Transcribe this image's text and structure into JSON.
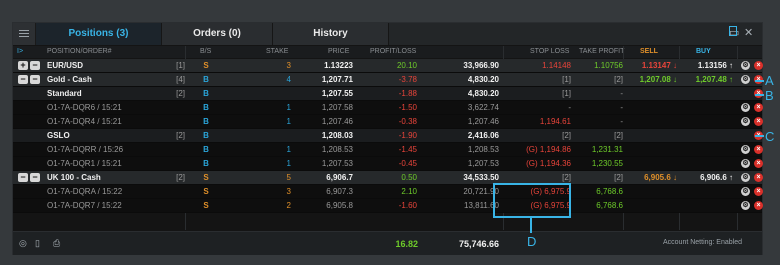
{
  "tabs": [
    {
      "label": "Positions (3)",
      "active": true
    },
    {
      "label": "Orders (0)",
      "active": false
    },
    {
      "label": "History",
      "active": false
    }
  ],
  "window_controls": {
    "minimize": "▭",
    "close": "✕"
  },
  "columns": {
    "position_order": "POSITION/ORDER#",
    "bs": "B/S",
    "stake": "STAKE",
    "price": "PRICE",
    "profit_loss": "PROFIT/LOSS",
    "stop_loss": "STOP LOSS",
    "take_profit": "TAKE PROFIT",
    "sell": "SELL",
    "buy": "BUY"
  },
  "rows": [
    {
      "level": 1,
      "expander": "+",
      "name": "EUR/USD",
      "tag": "[1]",
      "bs": "S",
      "bs_color": "orange",
      "stake": "3",
      "stake_color": "orange",
      "price": "1.13223",
      "pl": "20.10",
      "pl_color": "green",
      "value": "33,966.90",
      "sl": "1.14148",
      "sl_color": "red",
      "tp": "1.10756",
      "tp_color": "green",
      "sell": "1.13147",
      "sell_arrow": "↓",
      "buy": "1.13156",
      "buy_arrow": "↑",
      "actions": true
    },
    {
      "level": 1,
      "expander": "−",
      "name": "Gold - Cash",
      "tag": "[4]",
      "bs": "B",
      "bs_color": "blue",
      "stake": "4",
      "stake_color": "blue",
      "price": "1,207.71",
      "pl": "-3.78",
      "pl_color": "red",
      "value": "4,830.20",
      "sl": "[1]",
      "sl_color": "grey",
      "tp": "[2]",
      "tp_color": "grey",
      "sell": "1,207.08",
      "sell_arrow": "↓",
      "buy": "1,207.48",
      "buy_arrow": "↑",
      "actions": true,
      "callout": "A"
    },
    {
      "level": 2,
      "name": "Standard",
      "tag": "[2]",
      "bs": "B",
      "bs_color": "blue",
      "stake": "",
      "price": "1,207.55",
      "pl": "-1.88",
      "pl_color": "red",
      "value": "4,830.20",
      "sl": "[1]",
      "sl_color": "grey",
      "tp": "-",
      "tp_color": "grey",
      "close_only": true,
      "callout": "B"
    },
    {
      "level": 3,
      "name": "O1-7A-DQR6 / 15:21",
      "bs": "B",
      "bs_color": "blue",
      "stake": "1",
      "stake_color": "blue",
      "price": "1,207.58",
      "pl": "-1.50",
      "pl_color": "red",
      "value": "3,622.74",
      "sl": "-",
      "sl_color": "grey",
      "tp": "-",
      "tp_color": "grey",
      "actions": true
    },
    {
      "level": 3,
      "name": "O1-7A-DQR4 / 15:21",
      "bs": "B",
      "bs_color": "blue",
      "stake": "1",
      "stake_color": "blue",
      "price": "1,207.46",
      "pl": "-0.38",
      "pl_color": "red",
      "value": "1,207.46",
      "sl": "1,194.61",
      "sl_color": "red",
      "tp": "-",
      "tp_color": "grey",
      "actions": true
    },
    {
      "level": 2,
      "name": "GSLO",
      "tag": "[2]",
      "bs": "B",
      "bs_color": "blue",
      "stake": "",
      "price": "1,208.03",
      "pl": "-1.90",
      "pl_color": "red",
      "value": "2,416.06",
      "sl": "[2]",
      "sl_color": "grey",
      "tp": "[2]",
      "tp_color": "grey",
      "close_only": true,
      "callout": "C"
    },
    {
      "level": 3,
      "name": "O1-7A-DQRR / 15:26",
      "bs": "B",
      "bs_color": "blue",
      "stake": "1",
      "stake_color": "blue",
      "price": "1,208.53",
      "pl": "-1.45",
      "pl_color": "red",
      "value": "1,208.53",
      "sl": "(G) 1,194.86",
      "sl_color": "red",
      "tp": "1,231.31",
      "tp_color": "green",
      "actions": true
    },
    {
      "level": 3,
      "name": "O1-7A-DQR1 / 15:21",
      "bs": "B",
      "bs_color": "blue",
      "stake": "1",
      "stake_color": "blue",
      "price": "1,207.53",
      "pl": "-0.45",
      "pl_color": "red",
      "value": "1,207.53",
      "sl": "(G) 1,194.36",
      "sl_color": "red",
      "tp": "1,230.55",
      "tp_color": "green",
      "actions": true
    },
    {
      "level": 1,
      "expander": "−",
      "name": "UK 100 - Cash",
      "tag": "[2]",
      "bs": "S",
      "bs_color": "orange",
      "stake": "5",
      "stake_color": "orange",
      "price": "6,906.7",
      "pl": "0.50",
      "pl_color": "green",
      "value": "34,533.50",
      "sl": "[2]",
      "sl_color": "grey",
      "tp": "[2]",
      "tp_color": "grey",
      "sell": "6,905.6",
      "sell_arrow": "↓",
      "buy": "6,906.6",
      "buy_arrow": "↑",
      "actions": true
    },
    {
      "level": 3,
      "name": "O1-7A-DQRA / 15:22",
      "bs": "S",
      "bs_color": "orange",
      "stake": "3",
      "stake_color": "orange",
      "price": "6,907.3",
      "pl": "2.10",
      "pl_color": "green",
      "value": "20,721.90",
      "sl": "(G) 6,975.9",
      "sl_color": "red",
      "tp": "6,768.6",
      "tp_color": "green",
      "actions": true
    },
    {
      "level": 3,
      "name": "O1-7A-DQR7 / 15:22",
      "bs": "S",
      "bs_color": "orange",
      "stake": "2",
      "stake_color": "orange",
      "price": "6,905.8",
      "pl": "-1.60",
      "pl_color": "red",
      "value": "13,811.60",
      "sl": "(G) 6,975.9",
      "sl_color": "red",
      "tp": "6,768.6",
      "tp_color": "green",
      "actions": true
    }
  ],
  "footer": {
    "total_pl": "16.82",
    "total_value": "75,746.66",
    "netting": "Account Netting: Enabled"
  },
  "callouts": {
    "a": "A",
    "b": "B",
    "c": "C",
    "d": "D"
  },
  "colors": {
    "accent": "#39b4e6",
    "buy_blue": "#2aa4d8",
    "sell_orange": "#e0902a",
    "profit_green": "#6ecb2a",
    "loss_red": "#e8443a"
  }
}
